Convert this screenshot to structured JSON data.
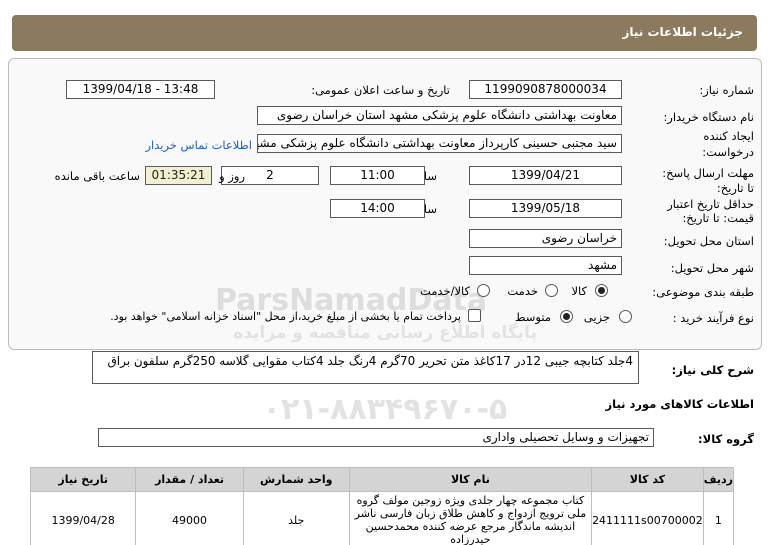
{
  "header": {
    "title": "جزئیات اطلاعات نیاز"
  },
  "form": {
    "need_number_label": "شماره نیاز:",
    "need_number": "1199090878000034",
    "announce_label": "تاریخ و ساعت اعلان عمومی:",
    "announce_value": "1399/04/18 - 13:48",
    "buyer_label": "نام دستگاه خریدار:",
    "buyer_value": "معاونت بهداشتی دانشگاه علوم پزشکی مشهد استان خراسان رضوی",
    "creator_label_1": "ایجاد کننده",
    "creator_label_2": "درخواست:",
    "creator_value": "سید مجتبی حسینی کارپرداز معاونت بهداشتی دانشگاه علوم پزشکی مشهد ا",
    "contact_link": "اطلاعات تماس خریدار",
    "deadline_label_1": "مهلت ارسال پاسخ:",
    "deadline_label_2": "تا تاریخ:",
    "deadline_date": "1399/04/21",
    "time_label": "ساعت",
    "deadline_time": "11:00",
    "days_value": "2",
    "days_label": "روز و",
    "remaining_time": "01:35:21",
    "remaining_label": "ساعت باقی مانده",
    "validity_label_1": "حداقل تاریخ اعتبار",
    "validity_label_2": "قیمت: تا تاریخ:",
    "validity_date": "1399/05/18",
    "validity_time": "14:00",
    "province_label": "استان محل تحویل:",
    "province_value": "خراسان رضوی",
    "city_label": "شهر محل تحویل:",
    "city_value": "مشهد",
    "category_label": "طبقه بندی موضوعی:",
    "category_options": [
      "کالا",
      "خدمت",
      "کالا/خدمت"
    ],
    "process_label": "نوع فرآیند خرید :",
    "process_options": [
      "جزیی",
      "متوسط"
    ],
    "payment_note": "پرداخت تمام یا بخشی از مبلغ خرید،از محل \"اسناد خزانه اسلامی\" خواهد بود."
  },
  "description": {
    "label": "شرح کلی نیاز:",
    "value": "4جلد کتابچه جیبی 12در 17کاغذ متن تحریر 70گرم 4رنگ جلد 4کتاب مقوایی گلاسه 250گرم سلفون براق"
  },
  "goods_section": {
    "title": "اطلاعات کالاهای مورد نیاز",
    "group_label": "گروه کالا:",
    "group_value": "تجهیزات و وسایل تحصیلی واداری"
  },
  "table": {
    "headers": [
      "ردیف",
      "کد کالا",
      "نام کالا",
      "واحد شمارش",
      "تعداد / مقدار",
      "تاریخ نیاز"
    ],
    "rows": [
      {
        "row": "1",
        "code": "2411111s00700002",
        "name": "کتاب مجموعه چهار جلدی ویژه زوجین مولف گروه ملی ترویج ازدواج و کاهش طلاق زبان فارسی ناشر اندیشه ماندگار مرجع عرضه کننده محمدحسین حیدرزاده",
        "unit": "جلد",
        "qty": "49000",
        "date": "1399/04/28"
      }
    ]
  },
  "watermark": {
    "line1": "ParsNamadData",
    "line2": "پایگاه اطلاع رسانی مناقصه و مزایده",
    "line3": "۰۲۱-۸۸۳۴۹۶۷۰-۵"
  }
}
